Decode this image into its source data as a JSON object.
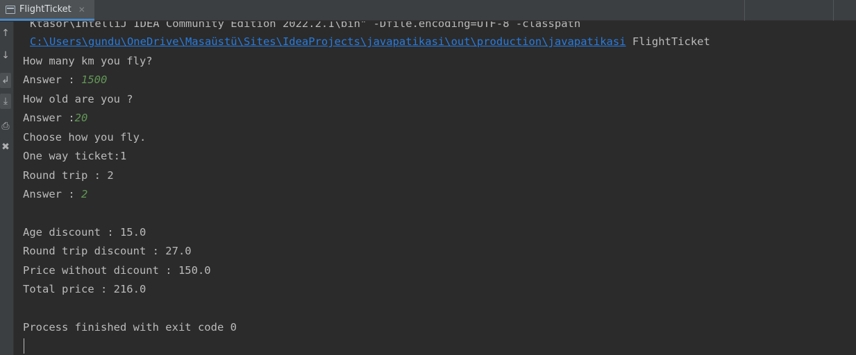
{
  "tab": {
    "label": "FlightTicket",
    "close_glyph": "✕"
  },
  "gutter": {
    "icons": [
      "arrow-up-icon",
      "arrow-down-icon",
      "soft-wrap-icon",
      "scroll-to-end-icon",
      "print-icon",
      "trash-icon"
    ]
  },
  "console": {
    "cmd_line": "Ktasor\\IntelliJ IDEA Community Edition 2022.2.1\\bin\" -Dfile.encoding=UTF-8 -classpath",
    "classpath_link": "C:\\Users\\gundu\\OneDrive\\Masaüstü\\Sites\\IdeaProjects\\javapatikasi\\out\\production\\javapatikasi",
    "classpath_main": " FlightTicket",
    "q_km": "How many km you fly?",
    "answer_km_prompt": "Answer : ",
    "answer_km_value": "1500",
    "q_age": "How old are you ?",
    "answer_age_prompt": "Answer :",
    "answer_age_value": "20",
    "q_type": "Choose how you fly.",
    "opt_one_way": "One way ticket:1",
    "opt_round": "Round trip : 2",
    "answer_type_prompt": "Answer : ",
    "answer_type_value": "2",
    "age_discount": "Age discount : 15.0",
    "round_discount": "Round trip discount : 27.0",
    "price_without": "Price without dicount : 150.0",
    "total_price": "Total price : 216.0",
    "process_finished": "Process finished with exit code 0"
  }
}
